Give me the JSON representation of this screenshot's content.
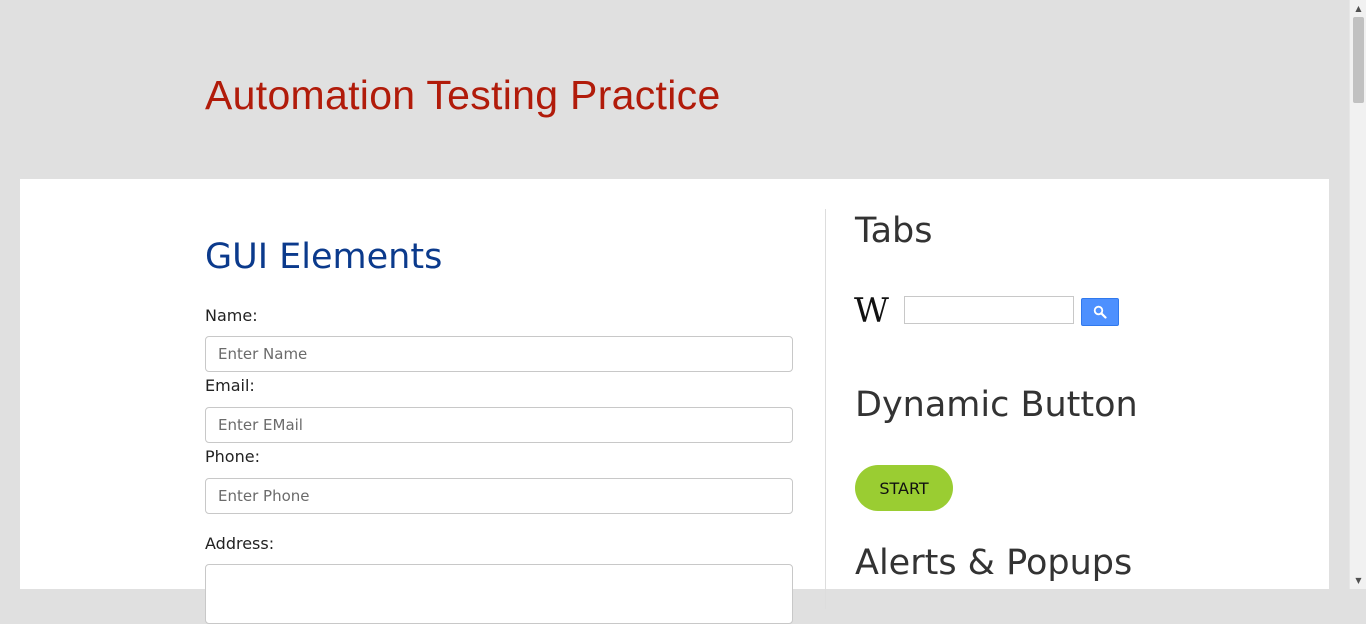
{
  "header": {
    "title": "Automation Testing Practice"
  },
  "main": {
    "section_title": "GUI Elements",
    "fields": {
      "name": {
        "label": "Name:",
        "placeholder": "Enter Name",
        "value": ""
      },
      "email": {
        "label": "Email:",
        "placeholder": "Enter EMail",
        "value": ""
      },
      "phone": {
        "label": "Phone:",
        "placeholder": "Enter Phone",
        "value": ""
      },
      "address": {
        "label": "Address:",
        "value": ""
      }
    }
  },
  "sidebar": {
    "tabs_title": "Tabs",
    "wiki_logo": "W",
    "dynamic_title": "Dynamic Button",
    "start_label": "START",
    "alerts_title": "Alerts & Popups"
  },
  "colors": {
    "site_title": "#b11b0a",
    "section_title": "#0b3a8c",
    "start_button": "#9acd32",
    "search_button": "#4d90fe"
  },
  "icons": {
    "wiki_search_button": "magnifier-icon",
    "scroll_up": "triangle-up-icon",
    "scroll_down": "triangle-down-icon"
  }
}
